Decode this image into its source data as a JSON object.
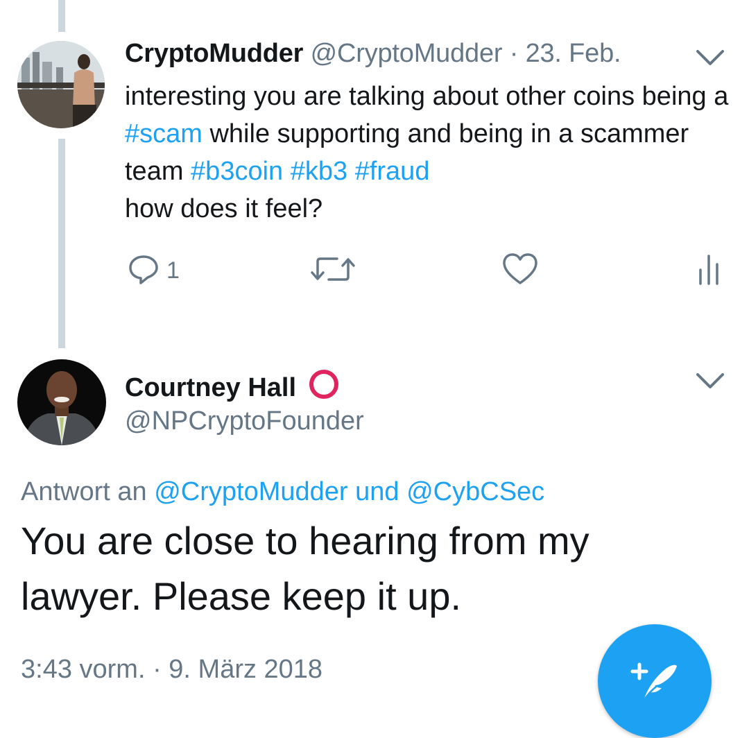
{
  "tweet1": {
    "display_name": "CryptoMudder",
    "handle": "@CryptoMudder",
    "separator": "·",
    "date": "23. Feb.",
    "text_parts": [
      "interesting you are talking about other coins being a ",
      "#scam",
      " while supporting and being in a scammer team ",
      "#b3coin",
      " ",
      "#kb3",
      " ",
      "#fraud",
      "how does it feel?"
    ],
    "reply_count": "1",
    "icons": [
      "reply-icon",
      "retweet-icon",
      "like-icon",
      "analytics-icon",
      "chevron-down-icon"
    ]
  },
  "tweet2": {
    "display_name": "Courtney Hall",
    "badge_icon": "red-circle-icon",
    "handle": "@NPCryptoFounder",
    "reply_prefix": "Antwort an",
    "reply_mention1": "@CryptoMudder",
    "reply_and": "und",
    "reply_mention2": "@CybCSec",
    "text": "You are close to hearing from my lawyer. Please keep it up.",
    "timestamp": "3:43 vorm. · 9. März 2018"
  },
  "fab": {
    "icon": "compose-tweet-icon"
  },
  "colors": {
    "accent": "#1da1f2",
    "secondary_text": "#657786",
    "primary_text": "#14171a",
    "thread_line": "#ccd6dd",
    "badge_red": "#e0245e"
  }
}
